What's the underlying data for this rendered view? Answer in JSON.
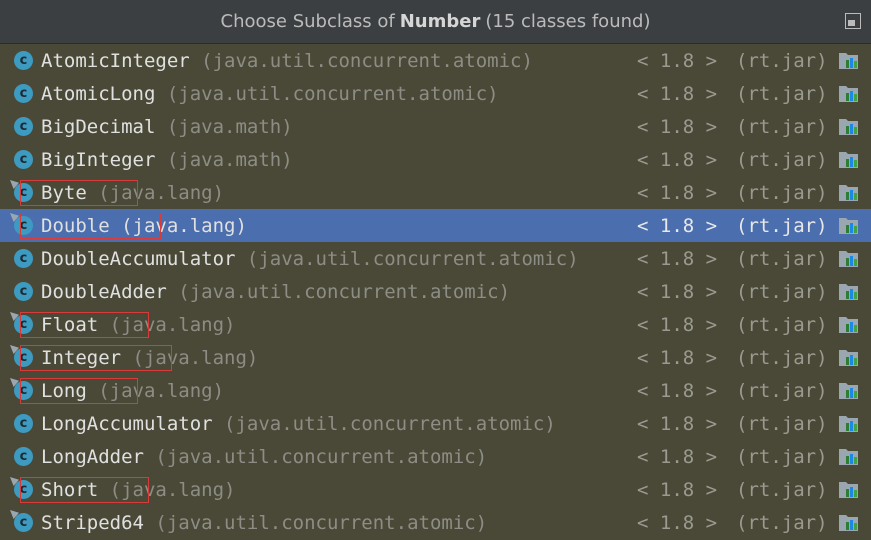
{
  "title": {
    "prefix": "Choose Subclass of",
    "bold": "Number",
    "suffix": "(15 classes found)"
  },
  "rows": [
    {
      "name": "AtomicInteger",
      "package": "(java.util.concurrent.atomic)",
      "version": "< 1.8 >",
      "jar": "(rt.jar)",
      "icon": "class-icon",
      "selected": false
    },
    {
      "name": "AtomicLong",
      "package": "(java.util.concurrent.atomic)",
      "version": "< 1.8 >",
      "jar": "(rt.jar)",
      "icon": "class-icon",
      "selected": false
    },
    {
      "name": "BigDecimal",
      "package": "(java.math)",
      "version": "< 1.8 >",
      "jar": "(rt.jar)",
      "icon": "class-icon",
      "selected": false
    },
    {
      "name": "BigInteger",
      "package": "(java.math)",
      "version": "< 1.8 >",
      "jar": "(rt.jar)",
      "icon": "class-icon",
      "selected": false
    },
    {
      "name": "Byte",
      "package": "(java.lang)",
      "version": "< 1.8 >",
      "jar": "(rt.jar)",
      "icon": "final-class-icon",
      "selected": false
    },
    {
      "name": "Double",
      "package": "(java.lang)",
      "version": "< 1.8 >",
      "jar": "(rt.jar)",
      "icon": "final-class-icon",
      "selected": true
    },
    {
      "name": "DoubleAccumulator",
      "package": "(java.util.concurrent.atomic)",
      "version": "< 1.8 >",
      "jar": "(rt.jar)",
      "icon": "class-icon",
      "selected": false
    },
    {
      "name": "DoubleAdder",
      "package": "(java.util.concurrent.atomic)",
      "version": "< 1.8 >",
      "jar": "(rt.jar)",
      "icon": "class-icon",
      "selected": false
    },
    {
      "name": "Float",
      "package": "(java.lang)",
      "version": "< 1.8 >",
      "jar": "(rt.jar)",
      "icon": "final-class-icon",
      "selected": false
    },
    {
      "name": "Integer",
      "package": "(java.lang)",
      "version": "< 1.8 >",
      "jar": "(rt.jar)",
      "icon": "final-class-icon",
      "selected": false
    },
    {
      "name": "Long",
      "package": "(java.lang)",
      "version": "< 1.8 >",
      "jar": "(rt.jar)",
      "icon": "final-class-icon",
      "selected": false
    },
    {
      "name": "LongAccumulator",
      "package": "(java.util.concurrent.atomic)",
      "version": "< 1.8 >",
      "jar": "(rt.jar)",
      "icon": "class-icon",
      "selected": false
    },
    {
      "name": "LongAdder",
      "package": "(java.util.concurrent.atomic)",
      "version": "< 1.8 >",
      "jar": "(rt.jar)",
      "icon": "class-icon",
      "selected": false
    },
    {
      "name": "Short",
      "package": "(java.lang)",
      "version": "< 1.8 >",
      "jar": "(rt.jar)",
      "icon": "final-class-icon",
      "selected": false
    },
    {
      "name": "Striped64",
      "package": "(java.util.concurrent.atomic)",
      "version": "< 1.8 >",
      "jar": "(rt.jar)",
      "icon": "final-class-icon",
      "selected": false
    }
  ],
  "highlighted_rows": [
    "Byte",
    "Double",
    "Float",
    "Integer",
    "Long",
    "Short"
  ],
  "colors": {
    "highlight_box": "#d93a3a",
    "selection": "#4b6eaf",
    "class_icon": "#3d9bc1"
  }
}
